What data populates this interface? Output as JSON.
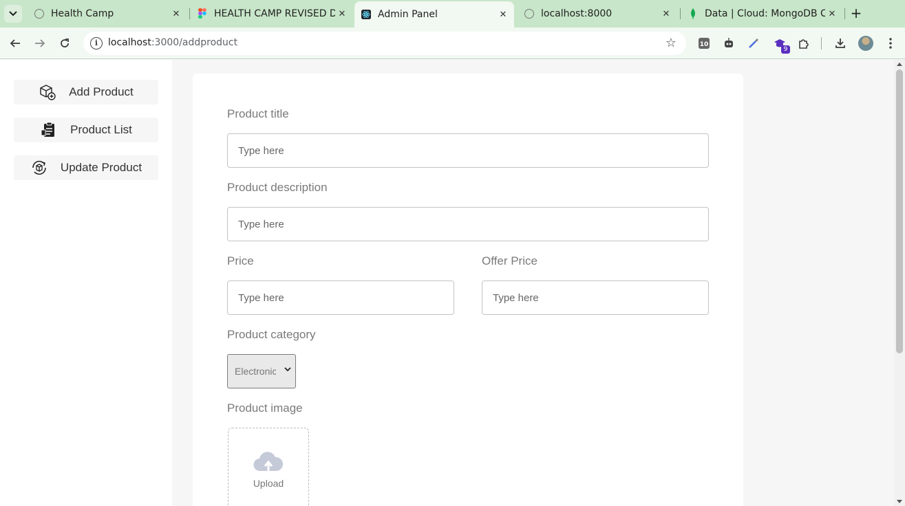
{
  "browser": {
    "tabs": [
      {
        "title": "Health Camp",
        "favicon": "globe-icon",
        "active": false
      },
      {
        "title": "HEALTH CAMP REVISED D",
        "favicon": "figma-icon",
        "active": false
      },
      {
        "title": "Admin Panel",
        "favicon": "react-icon",
        "active": true
      },
      {
        "title": "localhost:8000",
        "favicon": "globe-icon",
        "active": false
      },
      {
        "title": "Data | Cloud: MongoDB C",
        "favicon": "mongodb-leaf-icon",
        "active": false
      }
    ],
    "address": {
      "host": "localhost",
      "path": ":3000/addproduct"
    },
    "extension_badge": "9",
    "colors": {
      "frame": "#c8e6c9",
      "toolbar": "#f2f8f2"
    }
  },
  "sidebar": {
    "items": [
      {
        "label": "Add Product",
        "icon": "add-product-box-icon"
      },
      {
        "label": "Product List",
        "icon": "product-list-clipboard-icon"
      },
      {
        "label": "Update Product",
        "icon": "update-product-box-icon"
      }
    ]
  },
  "form": {
    "title_label": "Product title",
    "title_placeholder": "Type here",
    "description_label": "Product description",
    "description_placeholder": "Type here",
    "price_label": "Price",
    "price_placeholder": "Type here",
    "offer_price_label": "Offer Price",
    "offer_price_placeholder": "Type here",
    "category_label": "Product category",
    "category_selected": "Electronic",
    "image_label": "Product image",
    "upload_label": "Upload"
  }
}
